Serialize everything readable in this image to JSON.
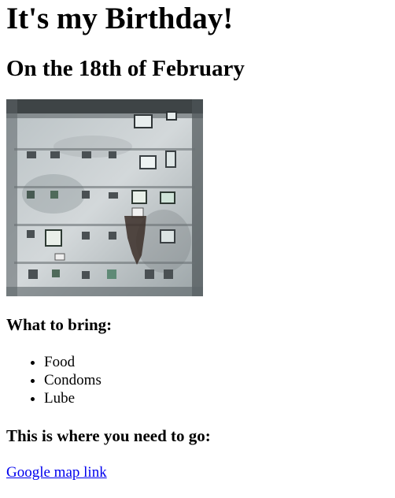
{
  "page": {
    "title": "It's my Birthday!",
    "date_heading": "On the 18th of February"
  },
  "photo": {
    "subject": "weathered apartment building facade"
  },
  "bring": {
    "heading": "What to bring:",
    "items": [
      "Food",
      "Condoms",
      "Lube"
    ]
  },
  "location": {
    "heading": "This is where you need to go:",
    "link_text": "Google map link"
  },
  "colors": {
    "link": "#0000ee",
    "text": "#000000"
  }
}
